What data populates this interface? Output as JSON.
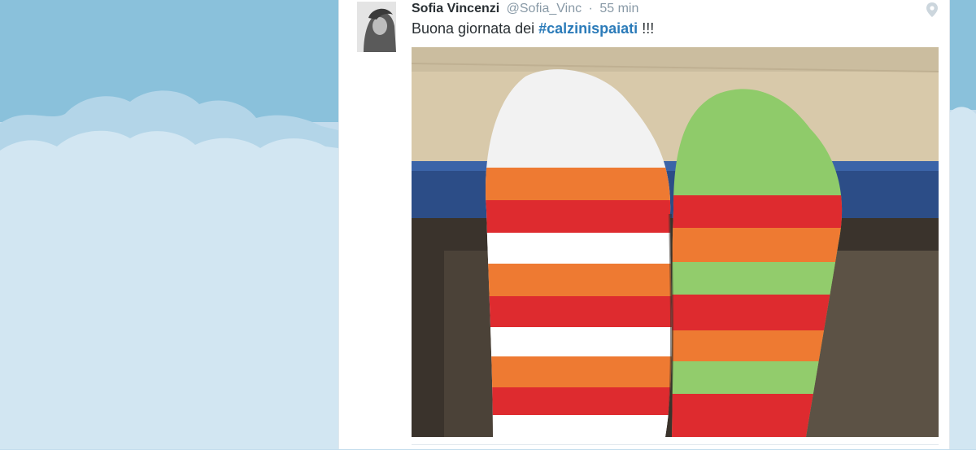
{
  "tweet": {
    "author_name": "Sofia Vincenzi",
    "author_handle": "@Sofia_Vinc",
    "separator": "·",
    "time_ago": "55 min",
    "text_before": "Buona giornata dei ",
    "hashtag": "#calzinispaiati",
    "text_after": " !!!",
    "media_alt": "Due calzini spaiati a righe appoggiati su una scrivania"
  },
  "icons": {
    "geo": "map-pin-icon"
  },
  "colors": {
    "background_sky": "#c3dced",
    "cloud": "#d6e8f4",
    "name_text": "#292f33",
    "meta_text": "#8899a6",
    "hashtag_link": "#2b7bb9",
    "panel": "#ffffff"
  }
}
